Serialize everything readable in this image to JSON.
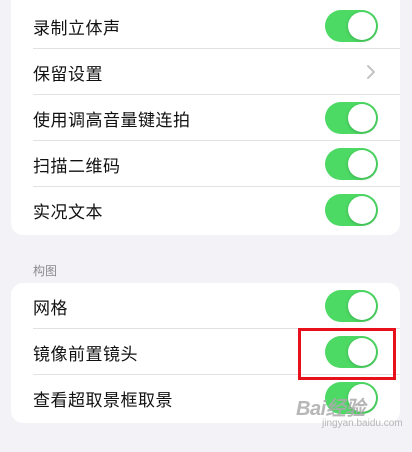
{
  "colors": {
    "toggle_on": "#4cd964",
    "highlight": "#e8101a",
    "background": "#f2f2f7"
  },
  "top_group": {
    "rows": [
      {
        "label": "录制立体声",
        "control": "toggle",
        "state": "on"
      },
      {
        "label": "保留设置",
        "control": "chevron"
      },
      {
        "label": "使用调高音量键连拍",
        "control": "toggle",
        "state": "on"
      },
      {
        "label": "扫描二维码",
        "control": "toggle",
        "state": "on"
      },
      {
        "label": "实况文本",
        "control": "toggle",
        "state": "on"
      }
    ]
  },
  "composition": {
    "header": "构图",
    "rows": [
      {
        "label": "网格",
        "control": "toggle",
        "state": "on"
      },
      {
        "label": "镜像前置镜头",
        "control": "toggle",
        "state": "on"
      },
      {
        "label": "查看超取景框取景",
        "control": "toggle",
        "state": "on"
      }
    ]
  },
  "watermark": {
    "main": "Bai经验",
    "sub": "jingyan.baidu.com"
  }
}
